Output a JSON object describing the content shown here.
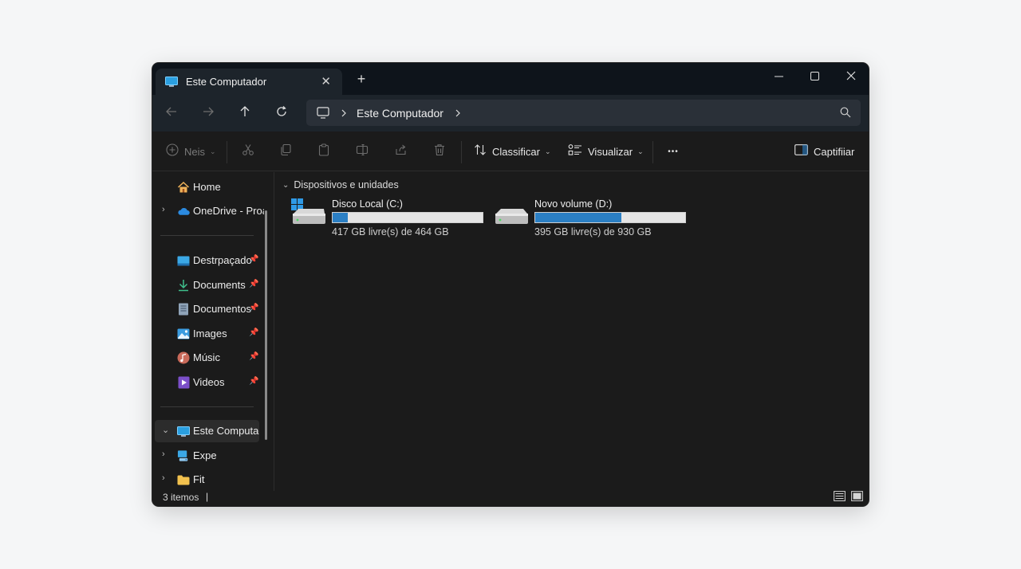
{
  "tab": {
    "title": "Este Computador",
    "close": "✕",
    "new_tab": "+"
  },
  "address": {
    "crumb": "Este Computador"
  },
  "toolbar": {
    "new_label": "Neis",
    "sort_label": "Classificar",
    "view_label": "Visualizar",
    "more_label": "•••",
    "details_label": "Captifiiar"
  },
  "sidebar": {
    "home": "Home",
    "onedrive": "OneDrive - Proa",
    "quick": [
      {
        "label": "Destrpaçado"
      },
      {
        "label": "Documents"
      },
      {
        "label": "Documentos"
      },
      {
        "label": "Images"
      },
      {
        "label": "Músic"
      },
      {
        "label": "Videos"
      }
    ],
    "this_pc": "Este Computador",
    "extra": [
      {
        "label": "Expe"
      },
      {
        "label": "Fit"
      }
    ]
  },
  "content": {
    "group_header": "Dispositivos e unidades",
    "drives": [
      {
        "name": "Disco Local (C:)",
        "size_text": "417 GB livre(s) de 464 GB",
        "used_fraction": 0.1
      },
      {
        "name": "Novo volume (D:)",
        "size_text": "395 GB livre(s) de 930 GB",
        "used_fraction": 0.575
      }
    ]
  },
  "status": {
    "items": "3 itemos",
    "cursor": "|"
  },
  "colors": {
    "accent": "#2b7fc4",
    "background": "#1b1b1b",
    "titlebar": "#0e141b",
    "navbar": "#1d242b"
  }
}
